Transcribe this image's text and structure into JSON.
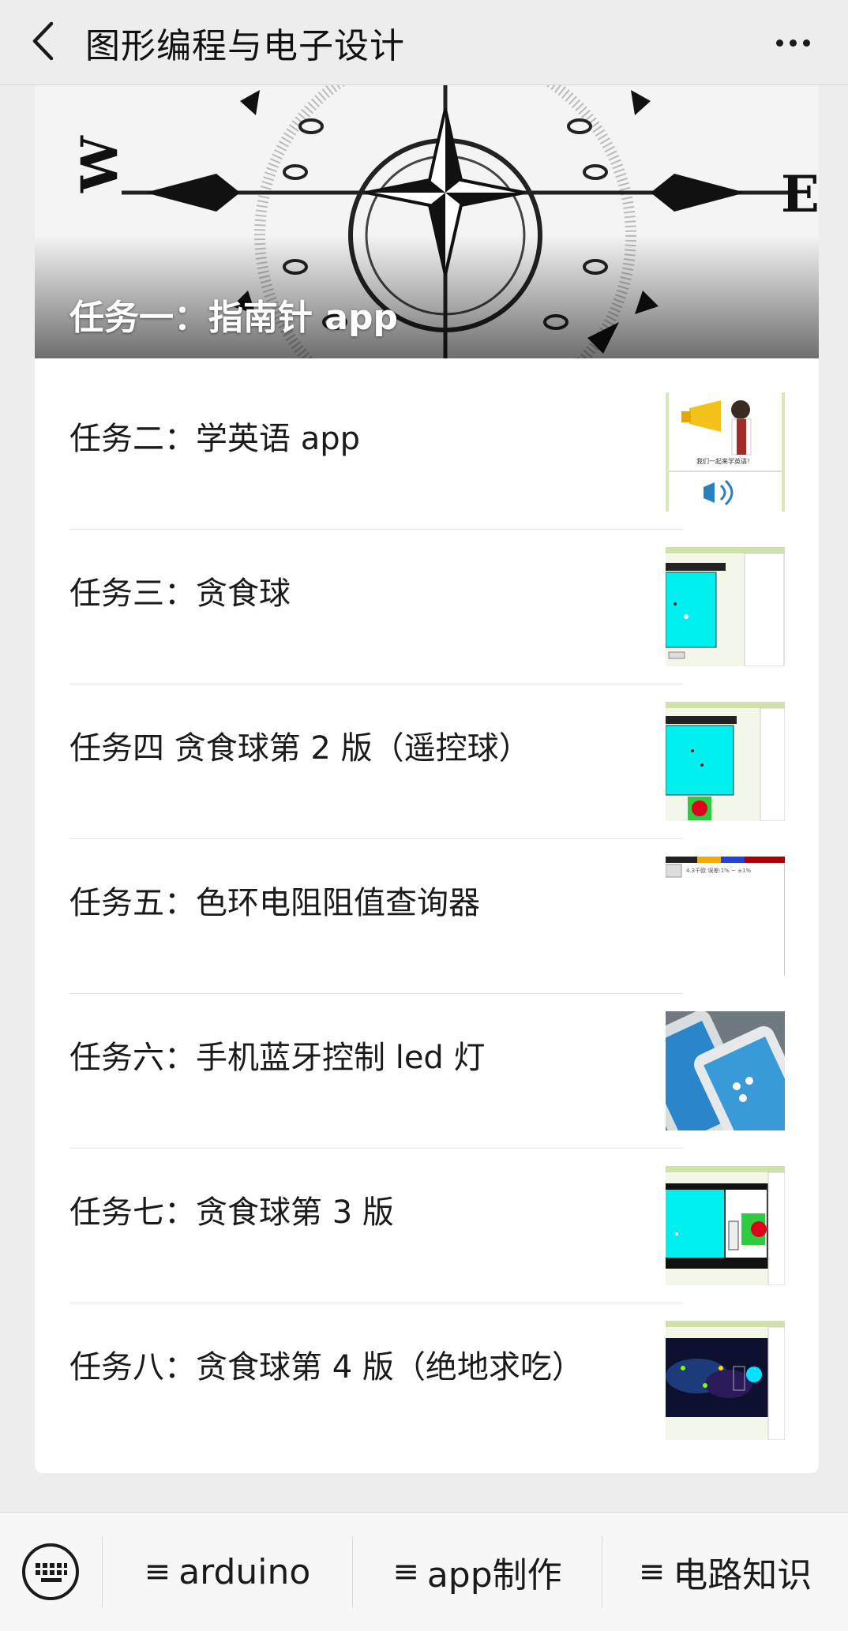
{
  "header": {
    "title": "图形编程与电子设计",
    "back_icon": "chevron-left-icon",
    "more_icon": "more-dots-icon"
  },
  "hero": {
    "title": "任务一：指南针 app"
  },
  "items": [
    {
      "label": "任务二：学英语 app",
      "thumb": "megaphone-english-thumb"
    },
    {
      "label": "任务三：贪食球",
      "thumb": "cyan-canvas-thumb"
    },
    {
      "label": "任务四 贪食球第 2 版（遥控球）",
      "thumb": "cyan-canvas-red-ball-thumb"
    },
    {
      "label": "任务五：色环电阻阻值查询器",
      "thumb": "resistor-app-thumb"
    },
    {
      "label": "任务六：手机蓝牙控制 led 灯",
      "thumb": "phones-photo-thumb"
    },
    {
      "label": "任务七：贪食球第 3 版",
      "thumb": "cyan-canvas-green-panel-thumb"
    },
    {
      "label": "任务八：贪食球第 4 版（绝地求吃）",
      "thumb": "dark-game-thumb"
    }
  ],
  "bottom_menu": {
    "keyboard_icon": "keyboard-icon",
    "items": [
      {
        "icon": "≡",
        "label": "arduino"
      },
      {
        "icon": "≡",
        "label": "app制作"
      },
      {
        "icon": "≡",
        "label": "电路知识"
      }
    ]
  },
  "colors": {
    "background": "#ededed",
    "card": "#ffffff",
    "thumb_cyan": "#00ffff"
  }
}
